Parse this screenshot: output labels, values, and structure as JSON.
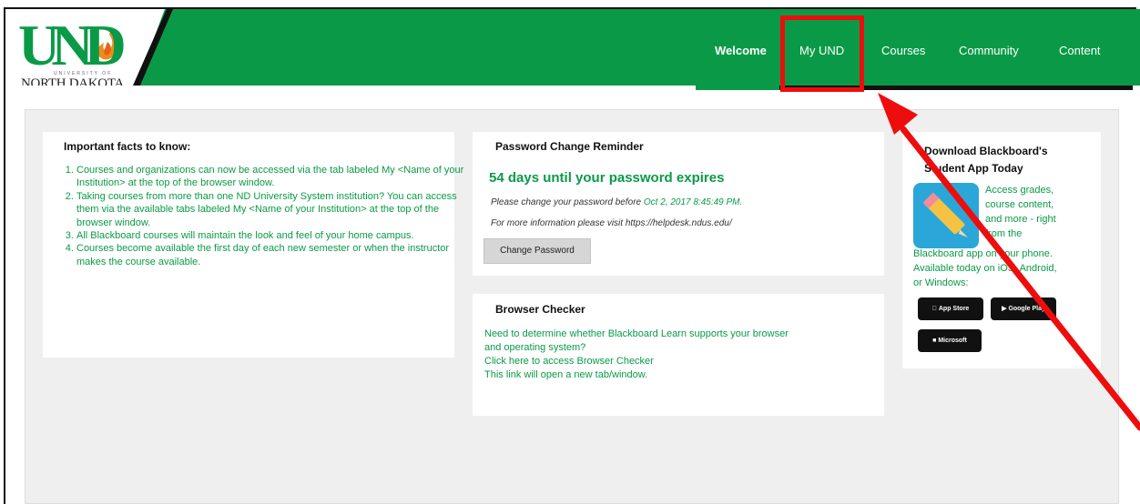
{
  "logo": {
    "wordmark": "UND",
    "small_text": "UNIVERSITY OF",
    "state_text": "NORTH DAKOTA."
  },
  "nav": {
    "items": [
      {
        "label": "Welcome"
      },
      {
        "label": "My UND"
      },
      {
        "label": "Courses"
      },
      {
        "label": "Community"
      },
      {
        "label": "Content"
      }
    ]
  },
  "facts": {
    "title": "Important facts to know:",
    "items": [
      "Courses and organizations can now be accessed via the tab labeled My <Name of your Institution> at the top of the browser window.",
      "Taking courses from more than one ND University System institution? You can access them via the available tabs labeled My <Name of your Institution> at the top of the browser window.",
      "All Blackboard courses will maintain the look and feel of your home campus.",
      "Courses become available the first day of each new semester or when the instructor makes the course available."
    ]
  },
  "password": {
    "title": "Password Change Reminder",
    "days": "54 days until your password expires",
    "before_text": "Please change your password before ",
    "before_date": "Oct 2, 2017 8:45:49 PM.",
    "info_text": "For more information please visit ",
    "info_link": "https://helpdesk.ndus.edu/",
    "button": "Change Password"
  },
  "browser_checker": {
    "title": "Browser Checker",
    "line1": "Need to determine whether Blackboard Learn supports your browser",
    "line2": "and operating system?",
    "line3": "Click here to access Browser Checker",
    "line4": "This link will open a new tab/window."
  },
  "blackboard_app": {
    "title": "Download Blackboard's Student App Today",
    "line1": "Access grades,",
    "line2": "course content,",
    "line3": "and more - right",
    "line4": "from the",
    "line5": "Blackboard app on your phone.",
    "line6": "Available today on iOS, Android,",
    "line7": "or Windows:",
    "app_store": "App Store",
    "google_play": "Google Play",
    "microsoft": "Microsoft"
  },
  "colors": {
    "accent": "#0a9a47",
    "highlight": "#ee0d0d",
    "app_icon": "#2aa7d8"
  },
  "icons": {
    "app_icon": "pencil-icon",
    "apple": "apple-icon",
    "google": "play-icon",
    "windows": "windows-icon"
  }
}
